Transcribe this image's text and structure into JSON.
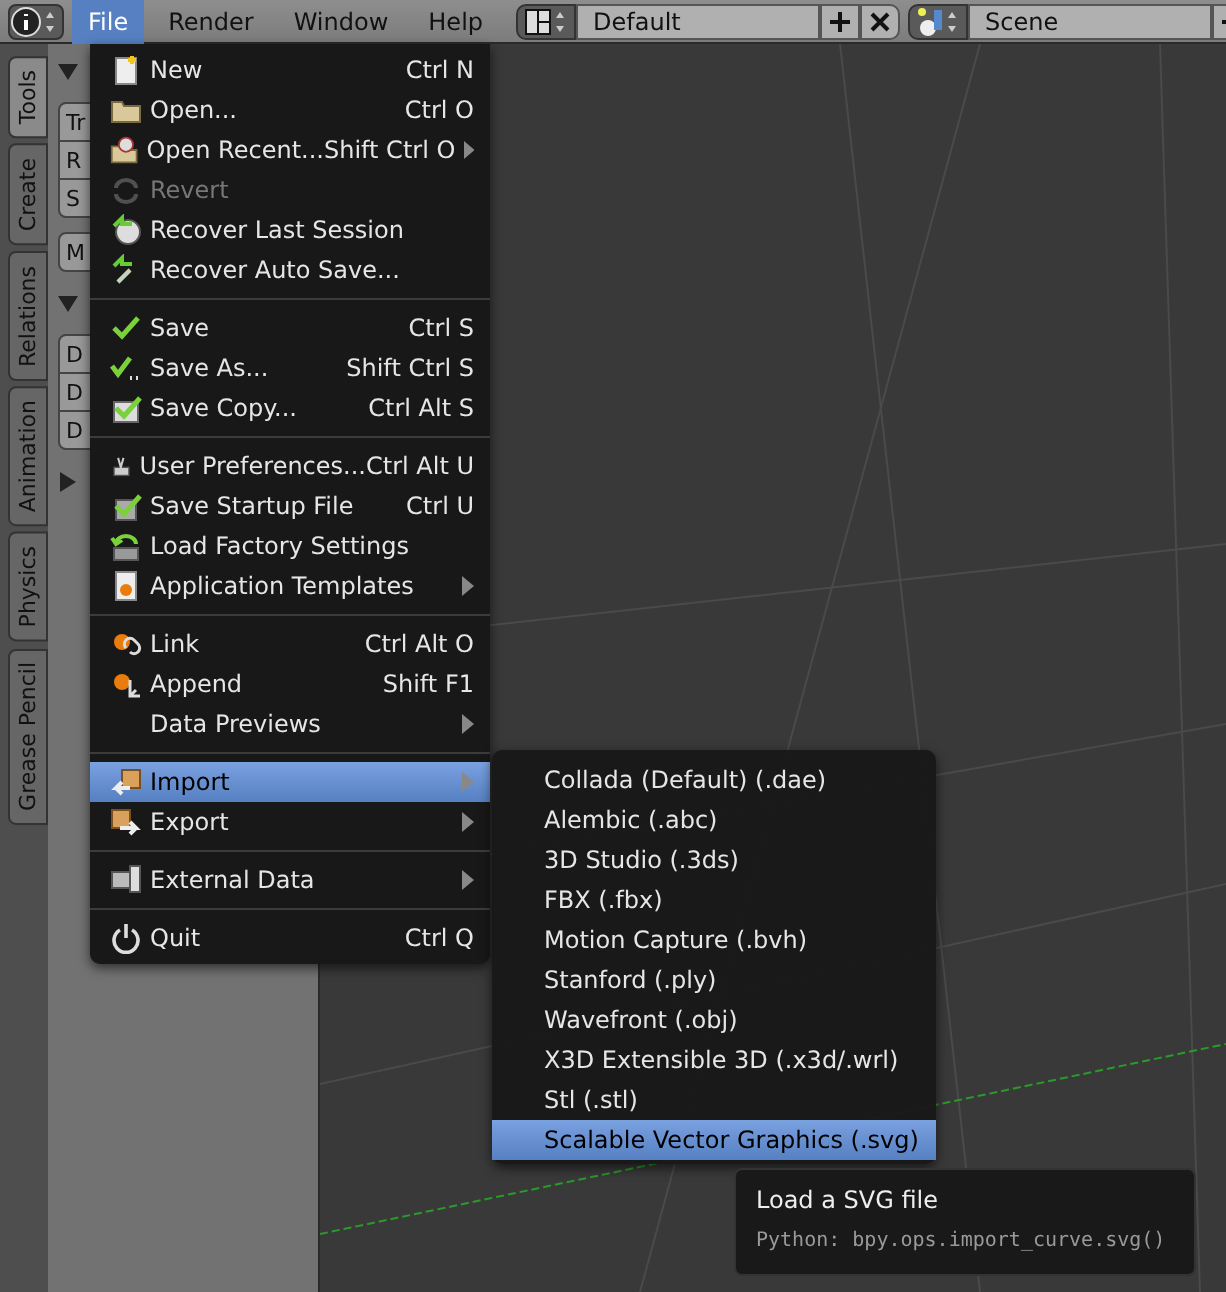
{
  "header": {
    "menus": [
      {
        "label": "File",
        "selected": true
      },
      {
        "label": "Render",
        "selected": false
      },
      {
        "label": "Window",
        "selected": false
      },
      {
        "label": "Help",
        "selected": false
      }
    ],
    "layout": "Default",
    "scene": "Scene"
  },
  "side_tabs": [
    {
      "label": "Tools",
      "selected": true
    },
    {
      "label": "Create",
      "selected": false
    },
    {
      "label": "Relations",
      "selected": false
    },
    {
      "label": "Animation",
      "selected": false
    },
    {
      "label": "Physics",
      "selected": false
    },
    {
      "label": "Grease Pencil",
      "selected": false
    }
  ],
  "tool_shelf": {
    "panels": [
      {
        "expanded": true,
        "groups": [
          [
            "Tr",
            "R",
            "S"
          ],
          [
            "M"
          ]
        ]
      },
      {
        "expanded": true,
        "groups": [
          [
            "D",
            "D",
            "D"
          ]
        ]
      },
      {
        "expanded": false
      }
    ]
  },
  "file_menu": {
    "sections": [
      [
        {
          "label": "New",
          "shortcut": "Ctrl N",
          "submenu": false,
          "disabled": false,
          "selected": false
        },
        {
          "label": "Open...",
          "shortcut": "Ctrl O",
          "submenu": false,
          "disabled": false,
          "selected": false
        },
        {
          "label": "Open Recent...",
          "shortcut": "Shift Ctrl O",
          "submenu": true,
          "disabled": false,
          "selected": false
        },
        {
          "label": "Revert",
          "submenu": false,
          "disabled": true,
          "selected": false
        },
        {
          "label": "Recover Last Session",
          "submenu": false,
          "disabled": false,
          "selected": false
        },
        {
          "label": "Recover Auto Save...",
          "submenu": false,
          "disabled": false,
          "selected": false
        }
      ],
      [
        {
          "label": "Save",
          "shortcut": "Ctrl S",
          "submenu": false,
          "disabled": false,
          "selected": false
        },
        {
          "label": "Save As...",
          "shortcut": "Shift Ctrl S",
          "submenu": false,
          "disabled": false,
          "selected": false
        },
        {
          "label": "Save Copy...",
          "shortcut": "Ctrl Alt S",
          "submenu": false,
          "disabled": false,
          "selected": false
        }
      ],
      [
        {
          "label": "User Preferences...",
          "shortcut": "Ctrl Alt U",
          "submenu": false,
          "disabled": false,
          "selected": false
        },
        {
          "label": "Save Startup File",
          "shortcut": "Ctrl U",
          "submenu": false,
          "disabled": false,
          "selected": false
        },
        {
          "label": "Load Factory Settings",
          "submenu": false,
          "disabled": false,
          "selected": false
        },
        {
          "label": "Application Templates",
          "submenu": true,
          "disabled": false,
          "selected": false
        }
      ],
      [
        {
          "label": "Link",
          "shortcut": "Ctrl Alt O",
          "submenu": false,
          "disabled": false,
          "selected": false
        },
        {
          "label": "Append",
          "shortcut": "Shift F1",
          "submenu": false,
          "disabled": false,
          "selected": false
        },
        {
          "label": "Data Previews",
          "submenu": true,
          "disabled": false,
          "selected": false
        }
      ],
      [
        {
          "label": "Import",
          "submenu": true,
          "disabled": false,
          "selected": true
        },
        {
          "label": "Export",
          "submenu": true,
          "disabled": false,
          "selected": false
        }
      ],
      [
        {
          "label": "External Data",
          "submenu": true,
          "disabled": false,
          "selected": false
        }
      ],
      [
        {
          "label": "Quit",
          "shortcut": "Ctrl Q",
          "submenu": false,
          "disabled": false,
          "selected": false
        }
      ]
    ]
  },
  "import_submenu": {
    "items": [
      {
        "label": "Collada (Default) (.dae)",
        "selected": false
      },
      {
        "label": "Alembic (.abc)",
        "selected": false
      },
      {
        "label": "3D Studio (.3ds)",
        "selected": false
      },
      {
        "label": "FBX (.fbx)",
        "selected": false
      },
      {
        "label": "Motion Capture (.bvh)",
        "selected": false
      },
      {
        "label": "Stanford (.ply)",
        "selected": false
      },
      {
        "label": "Wavefront (.obj)",
        "selected": false
      },
      {
        "label": "X3D Extensible 3D (.x3d/.wrl)",
        "selected": false
      },
      {
        "label": "Stl (.stl)",
        "selected": false
      },
      {
        "label": "Scalable Vector Graphics (.svg)",
        "selected": true
      }
    ]
  },
  "tooltip": {
    "title": "Load a SVG file",
    "python": "Python: bpy.ops.import_curve.svg()"
  }
}
